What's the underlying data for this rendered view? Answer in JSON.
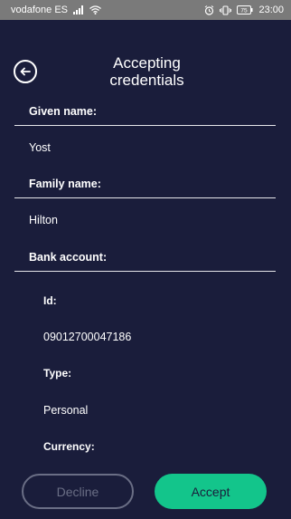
{
  "status_bar": {
    "carrier": "vodafone ES",
    "battery": "75",
    "time": "23:00"
  },
  "header": {
    "title": "Accepting\ncredentials"
  },
  "fields": {
    "given_name": {
      "label": "Given name:",
      "value": "Yost"
    },
    "family_name": {
      "label": "Family name:",
      "value": "Hilton"
    },
    "bank_account": {
      "label": "Bank account:",
      "id": {
        "label": "Id:",
        "value": "09012700047186"
      },
      "type": {
        "label": "Type:",
        "value": "Personal"
      },
      "currency": {
        "label": "Currency:"
      }
    }
  },
  "actions": {
    "decline_label": "Decline",
    "accept_label": "Accept"
  },
  "colors": {
    "background": "#1a1d3b",
    "accent": "#13c58b",
    "muted": "#6a6e85"
  }
}
